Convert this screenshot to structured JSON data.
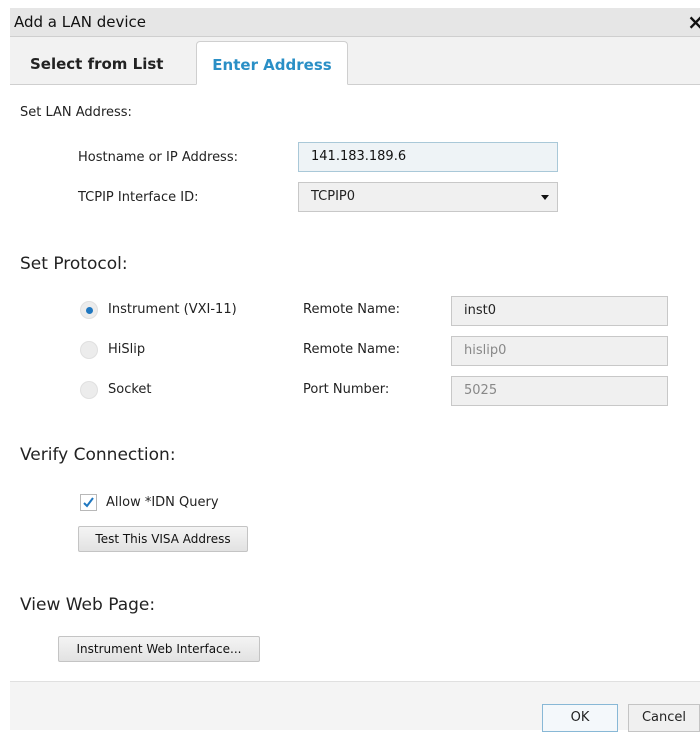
{
  "dialog": {
    "title": "Add a LAN device",
    "close_symbol": "×"
  },
  "tabs": [
    {
      "label": "Select from List",
      "active": false
    },
    {
      "label": "Enter Address",
      "active": true
    }
  ],
  "lan": {
    "section_label": "Set LAN Address:",
    "hostname_label": "Hostname or IP Address:",
    "hostname_value": "141.183.189.6",
    "interface_label": "TCPIP Interface ID:",
    "interface_value": "TCPIP0"
  },
  "protocol": {
    "section_label": "Set Protocol:",
    "options": [
      {
        "label": "Instrument (VXI-11)",
        "selected": true,
        "field_label": "Remote Name:",
        "field_value": "inst0"
      },
      {
        "label": "HiSlip",
        "selected": false,
        "field_label": "Remote Name:",
        "field_value": "hislip0"
      },
      {
        "label": "Socket",
        "selected": false,
        "field_label": "Port Number:",
        "field_value": "5025"
      }
    ]
  },
  "verify": {
    "section_label": "Verify Connection:",
    "idn_query_label": "Allow *IDN Query",
    "idn_query_checked": true,
    "test_button": "Test This VISA Address"
  },
  "webpage": {
    "section_label": "View Web Page:",
    "web_button": "Instrument Web Interface..."
  },
  "footer": {
    "ok_label": "OK",
    "cancel_label": "Cancel"
  },
  "colors": {
    "accent": "#2a8fc6",
    "radio_selected": "#1f77c0",
    "checkmark": "#1f77c0"
  }
}
